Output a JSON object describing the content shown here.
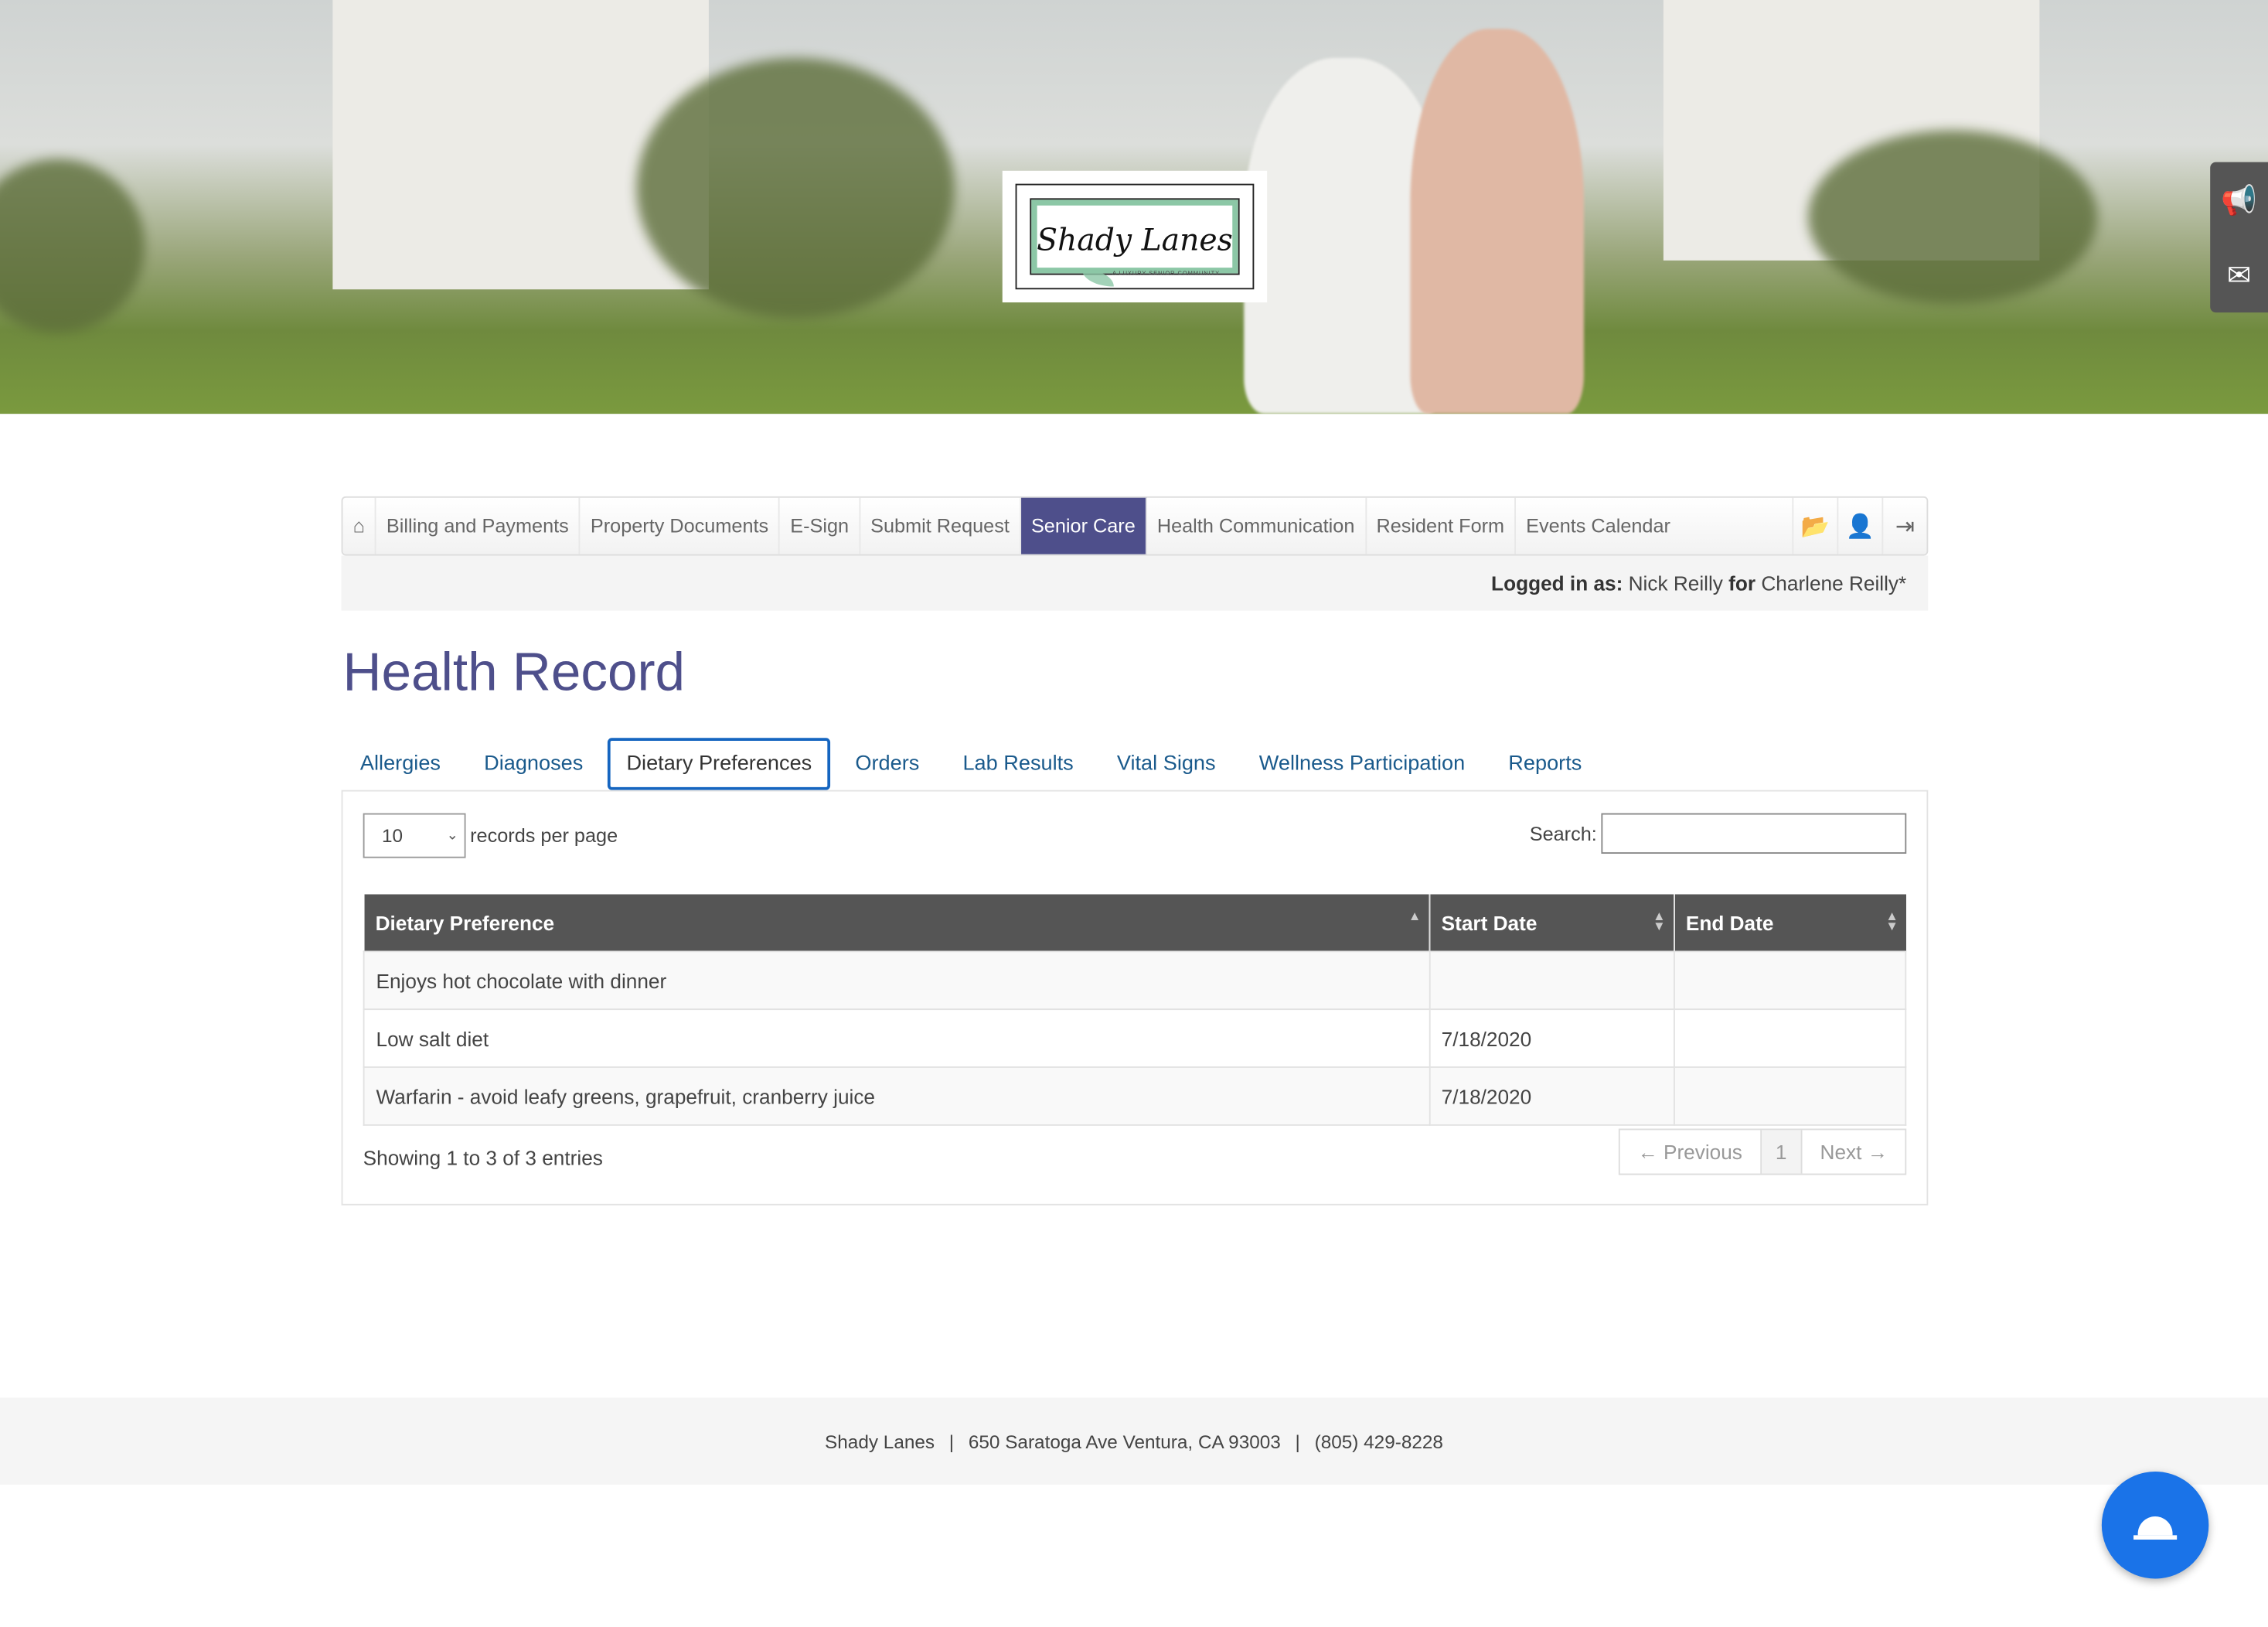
{
  "brand": {
    "logo_text": "Shady Lanes",
    "logo_tagline": "A LUXURY SENIOR COMMUNITY"
  },
  "side_tools": [
    {
      "icon": "megaphone-icon"
    },
    {
      "icon": "envelope-icon"
    }
  ],
  "nav": {
    "home_icon": "home-icon",
    "items": [
      {
        "label": "Billing and Payments"
      },
      {
        "label": "Property Documents"
      },
      {
        "label": "E-Sign"
      },
      {
        "label": "Submit Request"
      },
      {
        "label": "Senior Care",
        "active": true
      },
      {
        "label": "Health Communication"
      },
      {
        "label": "Resident Form"
      },
      {
        "label": "Events Calendar"
      }
    ],
    "right_icons": [
      "folder-open-icon",
      "user-icon",
      "sign-out-icon"
    ]
  },
  "login": {
    "prefix": "Logged in as:",
    "user": "Nick Reilly",
    "for": "for",
    "resident": "Charlene Reilly*"
  },
  "page_title": "Health Record",
  "tabs": [
    {
      "label": "Allergies"
    },
    {
      "label": "Diagnoses"
    },
    {
      "label": "Dietary Preferences",
      "active": true
    },
    {
      "label": "Orders"
    },
    {
      "label": "Lab Results"
    },
    {
      "label": "Vital Signs"
    },
    {
      "label": "Wellness Participation"
    },
    {
      "label": "Reports"
    }
  ],
  "table_controls": {
    "length_value": "10",
    "length_label": "records per page",
    "search_label": "Search:",
    "search_value": ""
  },
  "table": {
    "columns": [
      "Dietary Preference",
      "Start Date",
      "End Date"
    ],
    "rows": [
      [
        "Enjoys hot chocolate with dinner",
        "",
        ""
      ],
      [
        "Low salt diet",
        "7/18/2020",
        ""
      ],
      [
        "Warfarin - avoid leafy greens, grapefruit, cranberry juice",
        "7/18/2020",
        ""
      ]
    ]
  },
  "info": "Showing 1 to 3 of 3 entries",
  "pager": {
    "previous": "← Previous",
    "current": "1",
    "next": "Next →"
  },
  "footer": {
    "name": "Shady Lanes",
    "sep": "|",
    "address": "650 Saratoga Ave  Ventura, CA 93003",
    "phone": "(805) 429-8228"
  },
  "chat_button": {
    "icon": "concierge-bell-icon",
    "color": "#1a73e8"
  },
  "colors": {
    "accent": "#4e4f8b",
    "tab_active_border": "#1565c0",
    "table_header": "#555555"
  }
}
